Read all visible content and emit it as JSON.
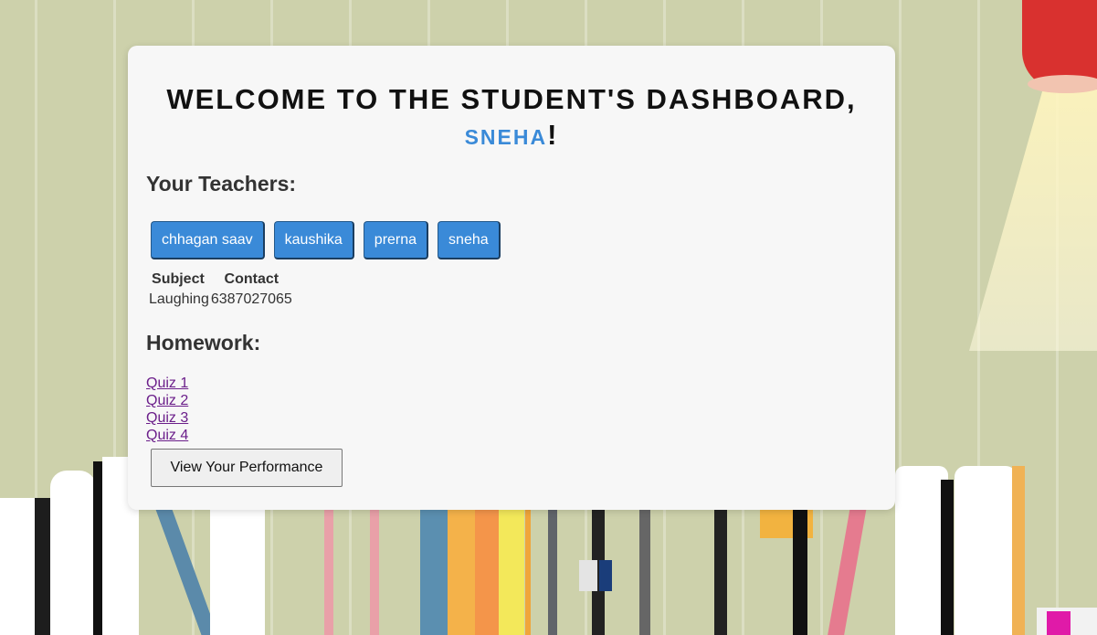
{
  "header": {
    "welcome_text": "WELCOME TO THE STUDENT'S DASHBOARD,",
    "student_name": "SNEHA",
    "exclamation": "!"
  },
  "teachers": {
    "heading": "Your Teachers:",
    "buttons": [
      "chhagan saav",
      "kaushika",
      "prerna",
      "sneha"
    ],
    "table": {
      "headers": [
        "Subject",
        "Contact"
      ],
      "rows": [
        [
          "Laughing",
          "6387027065"
        ]
      ]
    }
  },
  "homework": {
    "heading": "Homework:",
    "links": [
      "Quiz 1",
      "Quiz 2",
      "Quiz 3",
      "Quiz 4"
    ]
  },
  "performance_button": "View Your Performance",
  "colors": {
    "accent": "#3a8ad8",
    "panel": "#f7f7f7",
    "link": "#6b1e8a"
  }
}
